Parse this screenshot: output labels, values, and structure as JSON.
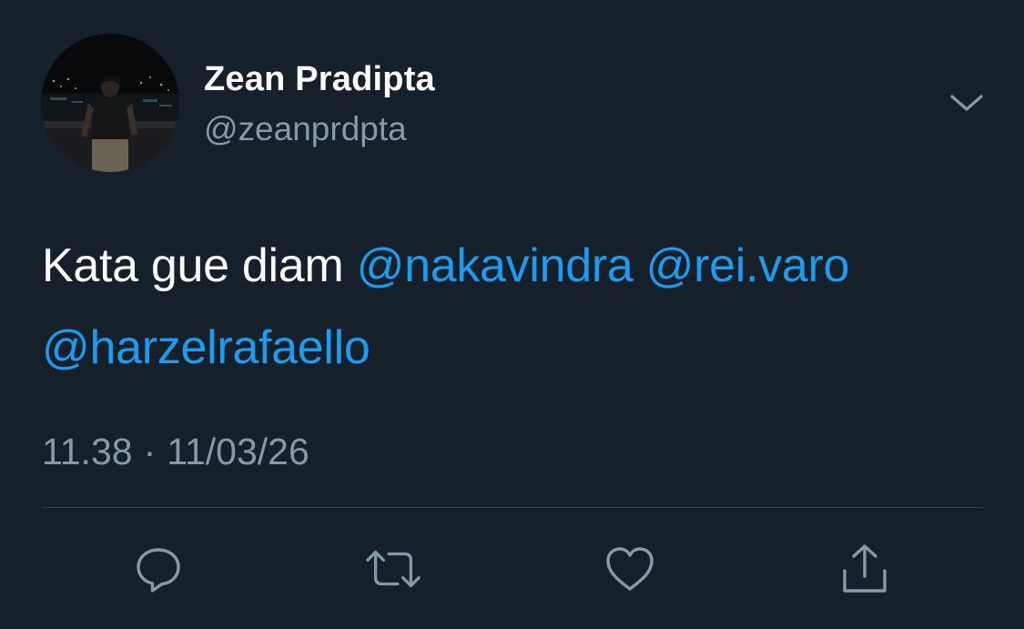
{
  "tweet": {
    "author": {
      "display_name": "Zean Pradipta",
      "handle": "@zeanprdpta"
    },
    "text_plain": "Kata gue diam",
    "mentions": [
      "@nakavindra",
      "@rei.varo",
      "@harzelrafaello"
    ],
    "time": "11.38",
    "separator": "·",
    "date": "11/03/26"
  },
  "icons": {
    "menu": "chevron-down-icon",
    "reply": "reply-icon",
    "retweet": "retweet-icon",
    "like": "heart-icon",
    "share": "share-icon"
  },
  "colors": {
    "background": "#15202b",
    "text": "#ffffff",
    "secondary_text": "#8899a6",
    "accent": "#1d9bf0",
    "divider": "#38444d"
  }
}
